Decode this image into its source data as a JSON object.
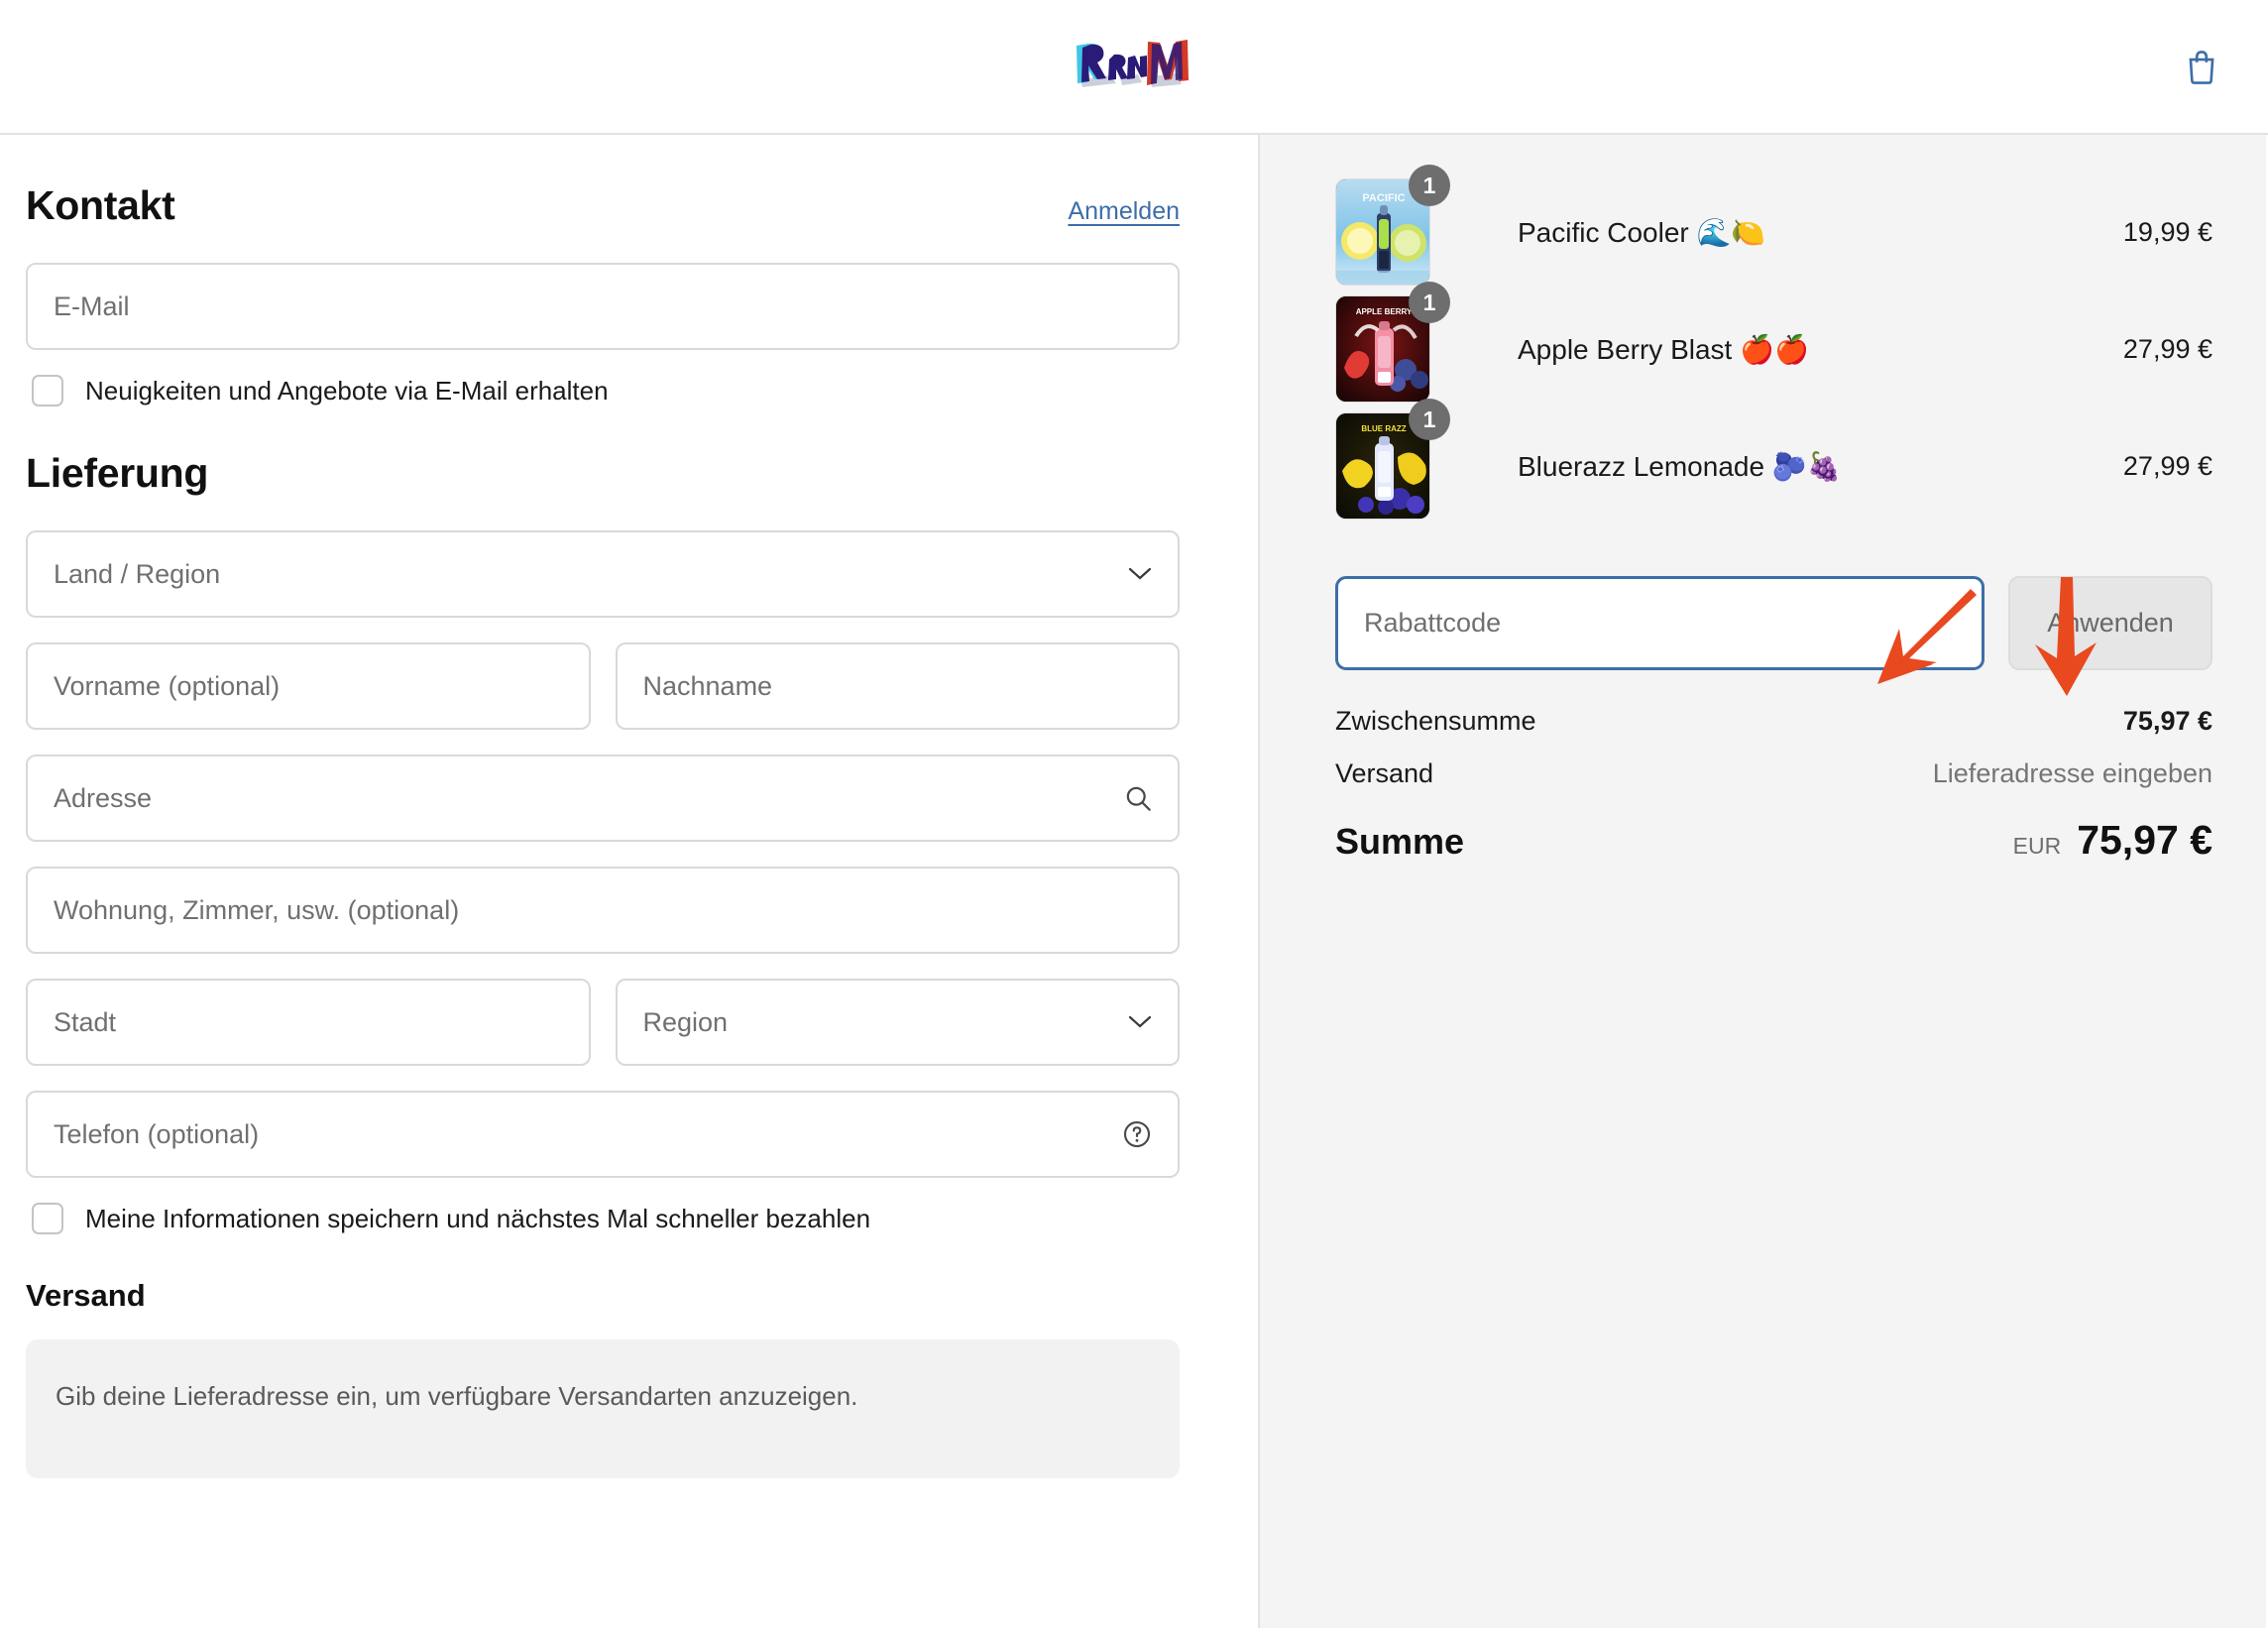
{
  "header": {
    "logo_text": "RandM",
    "logo_colors": {
      "r": "#3fc6e8",
      "and": "#2b1b78",
      "m": "#d43a24"
    },
    "cart_icon": "shopping-bag-icon",
    "cart_icon_color": "#3d6ea8"
  },
  "contact": {
    "title": "Kontakt",
    "login_link": "Anmelden",
    "email_placeholder": "E-Mail",
    "newsletter_label": "Neuigkeiten und Angebote via E-Mail erhalten",
    "newsletter_checked": false
  },
  "delivery": {
    "title": "Lieferung",
    "country_placeholder": "Land / Region",
    "firstname_placeholder": "Vorname (optional)",
    "lastname_placeholder": "Nachname",
    "address_placeholder": "Adresse",
    "address_icon": "search-icon",
    "apartment_placeholder": "Wohnung, Zimmer, usw. (optional)",
    "city_placeholder": "Stadt",
    "region_placeholder": "Region",
    "phone_placeholder": "Telefon (optional)",
    "phone_icon": "help-circle-icon",
    "save_info_label": "Meine Informationen speichern und nächstes Mal schneller bezahlen",
    "save_info_checked": false
  },
  "shipping": {
    "title": "Versand",
    "notice": "Gib deine Lieferadresse ein, um verfügbare Versandarten anzuzeigen."
  },
  "summary": {
    "items": [
      {
        "name": "Pacific Cooler 🌊🍋",
        "price": "19,99 €",
        "qty": "1",
        "thumb_label": "PACIFIC COOLER",
        "thumb_theme": "ice-blue-lemon"
      },
      {
        "name": "Apple Berry Blast 🍎🍎",
        "price": "27,99 €",
        "qty": "1",
        "thumb_label": "APPLE BERRY BLAST",
        "thumb_theme": "dark-red-berry"
      },
      {
        "name": "Bluerazz Lemonade 🫐🍇",
        "price": "27,99 €",
        "qty": "1",
        "thumb_label": "BLUE RAZZ LEMONADE",
        "thumb_theme": "dark-yellow-blueberry"
      }
    ],
    "discount_placeholder": "Rabattcode",
    "discount_value": "",
    "apply_label": "Anwenden",
    "subtotal_label": "Zwischensumme",
    "subtotal_value": "75,97 €",
    "shipping_label": "Versand",
    "shipping_value": "Lieferadresse eingeben",
    "total_label": "Summe",
    "total_currency": "EUR",
    "total_value": "75,97 €"
  },
  "annotations": {
    "arrow_color": "#e8491f",
    "arrows": [
      {
        "name": "arrow-to-discount-field",
        "direction": "down-left"
      },
      {
        "name": "arrow-to-apply-button",
        "direction": "down"
      }
    ]
  }
}
